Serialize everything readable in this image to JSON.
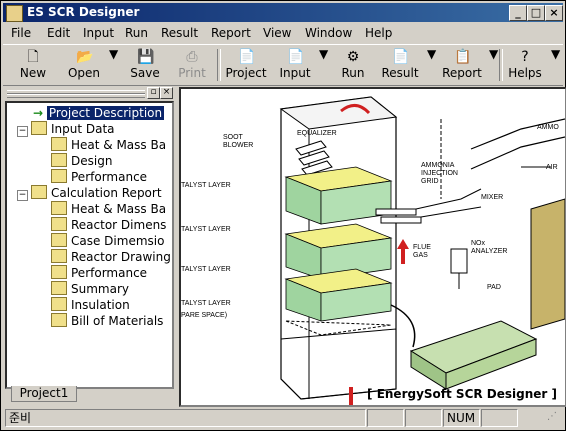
{
  "window": {
    "title": "ES SCR Designer"
  },
  "menu": [
    "File",
    "Edit",
    "Input",
    "Run",
    "Result",
    "Report",
    "View",
    "Window",
    "Help"
  ],
  "toolbar": [
    {
      "label": "New",
      "icon": "new-document-icon"
    },
    {
      "label": "Open",
      "icon": "folder-open-icon"
    },
    {
      "label": "Save",
      "icon": "floppy-save-icon"
    },
    {
      "label": "Print",
      "icon": "printer-icon"
    },
    {
      "label": "Project",
      "icon": "project-icon"
    },
    {
      "label": "Input",
      "icon": "input-icon"
    },
    {
      "label": "Run",
      "icon": "run-gear-icon"
    },
    {
      "label": "Result",
      "icon": "result-icon"
    },
    {
      "label": "Report",
      "icon": "report-icon"
    },
    {
      "label": "Helps",
      "icon": "question-help-icon"
    }
  ],
  "tree": {
    "items": [
      "Project Description",
      "Input Data",
      "Heat & Mass Ba",
      "Design",
      "Performance",
      "Calculation Report",
      "Heat & Mass Ba",
      "Reactor Dimens",
      "Case Dimemsio",
      "Reactor Drawing",
      "Performance",
      "Summary",
      "Insulation",
      "Bill of Materials"
    ],
    "tab": "Project1"
  },
  "drawing": {
    "labels": [
      "SOOT BLOWER",
      "EQUALIZER",
      "AMMONIA INJECTION GRID",
      "AIR",
      "MIXER",
      "TALYST LAYER",
      "TALYST LAYER",
      "TALYST LAYER",
      "TALYST LAYER PARE SPACE)",
      "FLUE GAS",
      "NOx ANALYZER",
      "PAD",
      "AMMO"
    ],
    "caption": "[ EnergySoft SCR Designer ]"
  },
  "status": {
    "left": "준비",
    "num": "NUM"
  }
}
